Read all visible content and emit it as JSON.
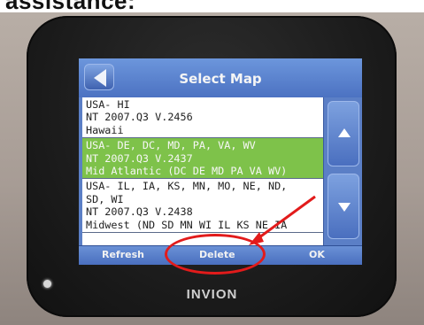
{
  "caption": "assistance:",
  "device": {
    "brand": "INVION"
  },
  "screen": {
    "title": "Select Map",
    "maps": [
      {
        "lines": [
          "USA- HI",
          "NT 2007.Q3 V.2456",
          "Hawaii"
        ],
        "selected": false
      },
      {
        "lines": [
          "USA- DE, DC, MD, PA, VA, WV",
          "NT 2007.Q3 V.2437",
          "Mid Atlantic (DC DE MD PA VA WV)"
        ],
        "selected": true
      },
      {
        "lines": [
          "USA- IL, IA, KS, MN, MO, NE, ND,",
          "SD, WI",
          "NT 2007.Q3 V.2438",
          "Midwest  (ND SD MN WI IL KS NE IA"
        ],
        "selected": false
      }
    ],
    "buttons": {
      "refresh": "Refresh",
      "delete": "Delete",
      "ok": "OK"
    },
    "icons": {
      "back": "back-arrow-icon",
      "up": "scroll-up-icon",
      "down": "scroll-down-icon"
    }
  },
  "colors": {
    "selected_row": "#7ec24a",
    "ui_blue": "#5b7fc6",
    "annotation": "#e21b1b"
  }
}
